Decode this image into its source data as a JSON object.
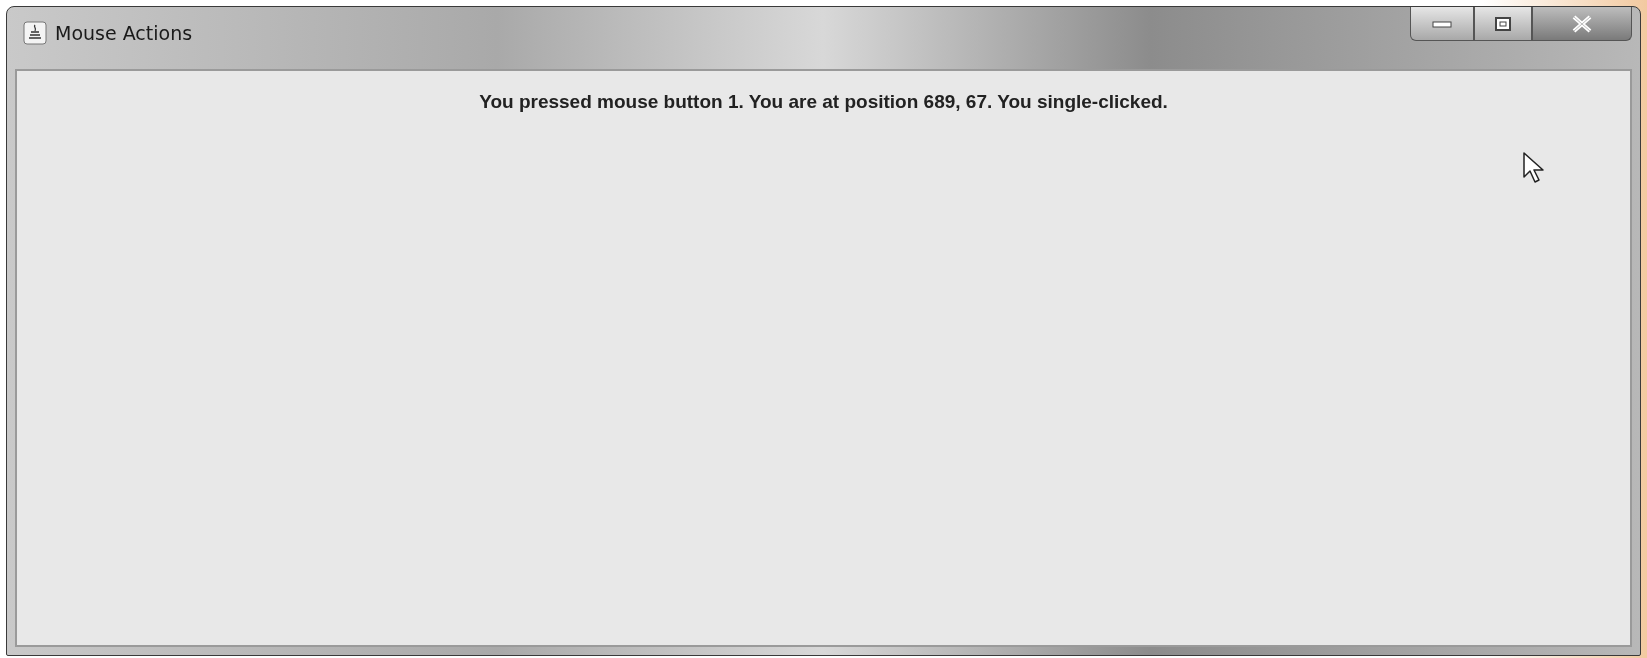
{
  "window": {
    "title": "Mouse Actions"
  },
  "message": "You pressed mouse button 1. You are at position 689, 67. You single-clicked."
}
